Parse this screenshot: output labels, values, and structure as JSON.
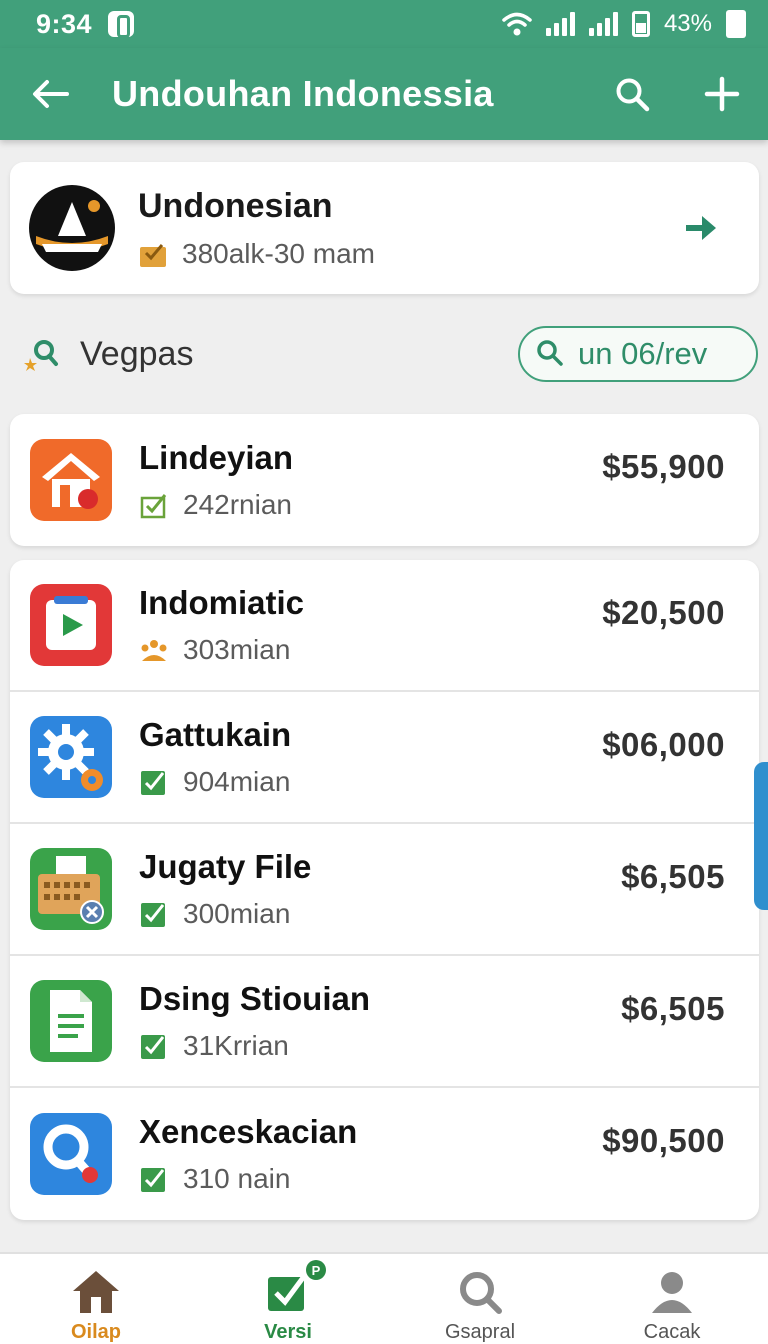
{
  "status_bar": {
    "time": "9:34",
    "battery": "43%"
  },
  "app_bar": {
    "title": "Undouhan Indonessia"
  },
  "featured": {
    "title": "Undonesian",
    "meta": "380alk-30 mam"
  },
  "section": {
    "title": "Vegpas",
    "filter": "un 06/rev"
  },
  "top_item": {
    "name": "Lindeyian",
    "meta": "242rnian",
    "price": "$55,900"
  },
  "items": [
    {
      "name": "Indomiatic",
      "meta": "303mian",
      "price": "$20,500"
    },
    {
      "name": "Gattukain",
      "meta": "904mian",
      "price": "$06,000"
    },
    {
      "name": "Jugaty File",
      "meta": "300mian",
      "price": "$6,505"
    },
    {
      "name": "Dsing Stiouian",
      "meta": "31Krrian",
      "price": "$6,505"
    },
    {
      "name": "Xenceskacian",
      "meta": "310 nain",
      "price": "$90,500"
    }
  ],
  "bottom_nav": {
    "items": [
      {
        "label": "Oilap"
      },
      {
        "label": "Versi",
        "badge": "P"
      },
      {
        "label": "Gsapral"
      },
      {
        "label": "Cacak"
      }
    ]
  },
  "colors": {
    "primary": "#41a07b",
    "accent_orange": "#d98a1e",
    "accent_green": "#2a8a45",
    "scroll_blue": "#2f8fce"
  }
}
